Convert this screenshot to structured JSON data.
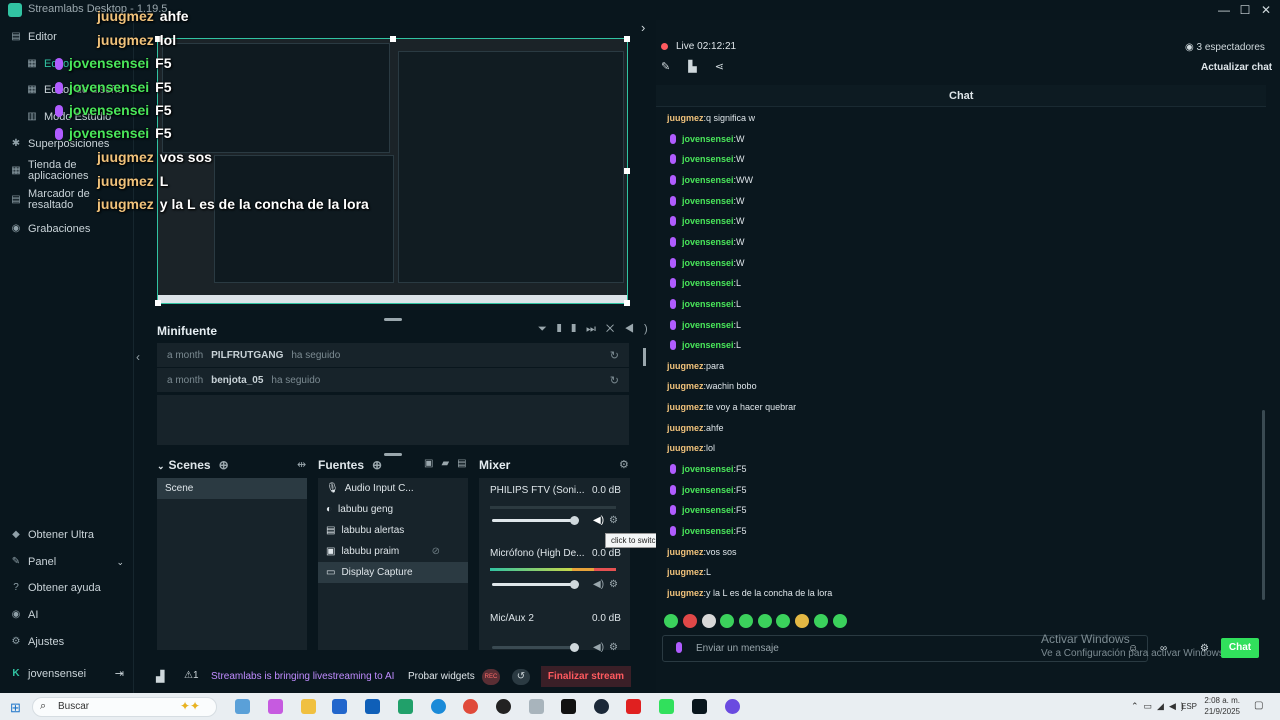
{
  "window": {
    "title": "Streamlabs Desktop - 1.19.5"
  },
  "nav": {
    "editor_header": "Editor",
    "items": [
      "Editor",
      "Editor de diseño",
      "Modo Estudio",
      "Superposiciones",
      "Tienda de\naplicaciones",
      "Marcador de\nresaltado",
      "Grabaciones"
    ],
    "bottom": [
      "Obtener Ultra",
      "Panel",
      "Obtener ayuda",
      "AI",
      "Ajustes"
    ],
    "user": "jovensensei"
  },
  "overlay_chat": [
    {
      "user": "juugmez",
      "text": "ahfe",
      "mic": false
    },
    {
      "user": "juugmez",
      "text": "lol",
      "mic": false
    },
    {
      "user": "jovensensei",
      "text": "F5",
      "mic": true
    },
    {
      "user": "jovensensei",
      "text": "F5",
      "mic": true
    },
    {
      "user": "jovensensei",
      "text": "F5",
      "mic": true
    },
    {
      "user": "jovensensei",
      "text": "F5",
      "mic": true
    },
    {
      "user": "juugmez",
      "text": "vos sos",
      "mic": false
    },
    {
      "user": "juugmez",
      "text": "L",
      "mic": false
    },
    {
      "user": "juugmez",
      "text": "y la L es de la concha de la lora",
      "mic": false
    }
  ],
  "minifuente": {
    "title": "Minifuente",
    "events": [
      {
        "when": "a month",
        "who": "PILFRUTGANG",
        "what": "ha seguido"
      },
      {
        "when": "a month",
        "who": "benjota_05",
        "what": "ha seguido"
      }
    ]
  },
  "scenes": {
    "title": "Scenes",
    "items": [
      "Scene"
    ]
  },
  "sources": {
    "title": "Fuentes",
    "items": [
      "Audio Input C...",
      "labubu geng",
      "labubu alertas",
      "labubu praim",
      "Display Capture"
    ]
  },
  "mixer": {
    "title": "Mixer",
    "channels": [
      {
        "name": "PHILIPS FTV (Soni...",
        "db": "0.0 dB"
      },
      {
        "name": "Micrófono (High De...",
        "db": "0.0 dB"
      },
      {
        "name": "Mic/Aux 2",
        "db": "0.0 dB"
      }
    ],
    "tooltip": "click to switch off"
  },
  "bottombar": {
    "badge": "1",
    "marquee": "Streamlabs is bringing livestreaming to AI gla",
    "widgets": "Probar widgets",
    "rec": "REC",
    "end": "Finalizar stream"
  },
  "chat": {
    "live": "Live",
    "time": "02:12:21",
    "viewers": "3 espectadores",
    "refresh": "Actualizar chat",
    "title": "Chat",
    "placeholder": "Enviar un mensaje",
    "send": "Chat",
    "messages": [
      {
        "user": "juugmez",
        "text": "q significa w",
        "mic": false
      },
      {
        "user": "jovensensei",
        "text": "W",
        "mic": true
      },
      {
        "user": "jovensensei",
        "text": "W",
        "mic": true
      },
      {
        "user": "jovensensei",
        "text": "WW",
        "mic": true
      },
      {
        "user": "jovensensei",
        "text": "W",
        "mic": true
      },
      {
        "user": "jovensensei",
        "text": "W",
        "mic": true
      },
      {
        "user": "jovensensei",
        "text": "W",
        "mic": true
      },
      {
        "user": "jovensensei",
        "text": "W",
        "mic": true
      },
      {
        "user": "jovensensei",
        "text": "L",
        "mic": true
      },
      {
        "user": "jovensensei",
        "text": "L",
        "mic": true
      },
      {
        "user": "jovensensei",
        "text": "L",
        "mic": true
      },
      {
        "user": "jovensensei",
        "text": "L",
        "mic": true
      },
      {
        "user": "juugmez",
        "text": "para",
        "mic": false
      },
      {
        "user": "juugmez",
        "text": "wachin bobo",
        "mic": false
      },
      {
        "user": "juugmez",
        "text": "te voy a hacer quebrar",
        "mic": false
      },
      {
        "user": "juugmez",
        "text": "ahfe",
        "mic": false
      },
      {
        "user": "juugmez",
        "text": "lol",
        "mic": false
      },
      {
        "user": "jovensensei",
        "text": "F5",
        "mic": true
      },
      {
        "user": "jovensensei",
        "text": "F5",
        "mic": true
      },
      {
        "user": "jovensensei",
        "text": "F5",
        "mic": true
      },
      {
        "user": "jovensensei",
        "text": "F5",
        "mic": true
      },
      {
        "user": "juugmez",
        "text": "vos sos",
        "mic": false
      },
      {
        "user": "juugmez",
        "text": "L",
        "mic": false
      },
      {
        "user": "juugmez",
        "text": "y la L es de la concha de la lora",
        "mic": false
      }
    ]
  },
  "watermark": {
    "line1": "Activar Windows",
    "line2": "Ve a Configuración para activar Windows."
  },
  "taskbar": {
    "search": "Buscar",
    "lang": "ESP",
    "time": "2:08 a. m.",
    "date": "21/9/2025"
  },
  "colors": {
    "accent": "#31c3a2",
    "mod_user": "#f0c27b",
    "user": "#49e65a",
    "end_stream": "#ff5a5f"
  }
}
